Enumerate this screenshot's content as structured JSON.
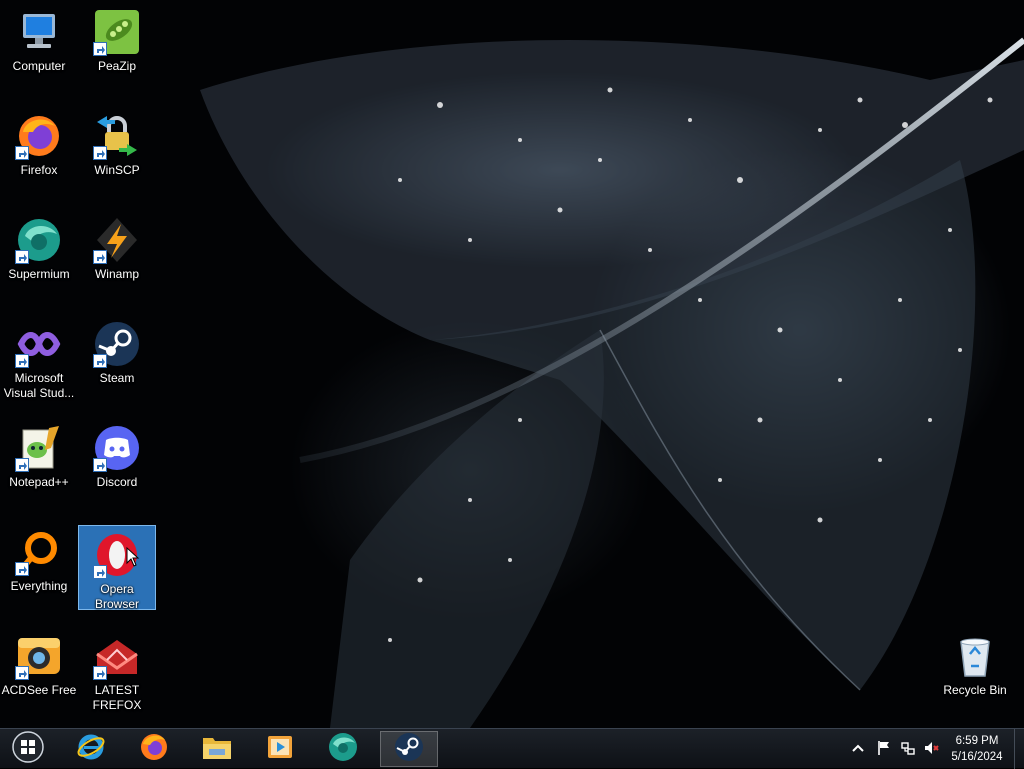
{
  "desktop": {
    "icons": [
      {
        "label": "Computer",
        "icon": "computer-icon",
        "shortcut": false
      },
      {
        "label": "PeaZip",
        "icon": "peazip-icon",
        "shortcut": true
      },
      {
        "label": "Firefox",
        "icon": "firefox-icon",
        "shortcut": true
      },
      {
        "label": "WinSCP",
        "icon": "winscp-icon",
        "shortcut": true
      },
      {
        "label": "Supermium",
        "icon": "supermium-icon",
        "shortcut": true
      },
      {
        "label": "Winamp",
        "icon": "winamp-icon",
        "shortcut": true
      },
      {
        "label": "Microsoft Visual Stud...",
        "icon": "visual-studio-icon",
        "shortcut": true
      },
      {
        "label": "Steam",
        "icon": "steam-icon",
        "shortcut": true
      },
      {
        "label": "Notepad++",
        "icon": "notepad-plus-plus-icon",
        "shortcut": true
      },
      {
        "label": "Discord",
        "icon": "discord-icon",
        "shortcut": true
      },
      {
        "label": "Everything",
        "icon": "everything-search-icon",
        "shortcut": true
      },
      {
        "label": "Opera Browser",
        "icon": "opera-icon",
        "shortcut": true,
        "selected": true
      },
      {
        "label": "ACDSee Free",
        "icon": "acdsee-icon",
        "shortcut": true
      },
      {
        "label": "LATEST FREFOX",
        "icon": "latest-frefox-icon",
        "shortcut": true
      }
    ],
    "recycle_bin": {
      "label": "Recycle Bin",
      "icon": "recycle-bin-icon"
    }
  },
  "taskbar": {
    "start": {
      "icon": "windows-start-icon"
    },
    "pinned": [
      {
        "icon": "internet-explorer-icon"
      },
      {
        "icon": "firefox-icon"
      },
      {
        "icon": "file-explorer-icon"
      },
      {
        "icon": "media-player-icon"
      },
      {
        "icon": "supermium-icon"
      },
      {
        "icon": "steam-icon",
        "active": true
      }
    ],
    "tray": {
      "icons": [
        "show-hidden-icons-chevron-icon",
        "action-center-flag-icon",
        "network-icon",
        "volume-muted-icon"
      ],
      "time": "6:59 PM",
      "date": "5/16/2024"
    }
  },
  "colors": {
    "selection": "#3385d6",
    "taskbar": "#161a20"
  }
}
